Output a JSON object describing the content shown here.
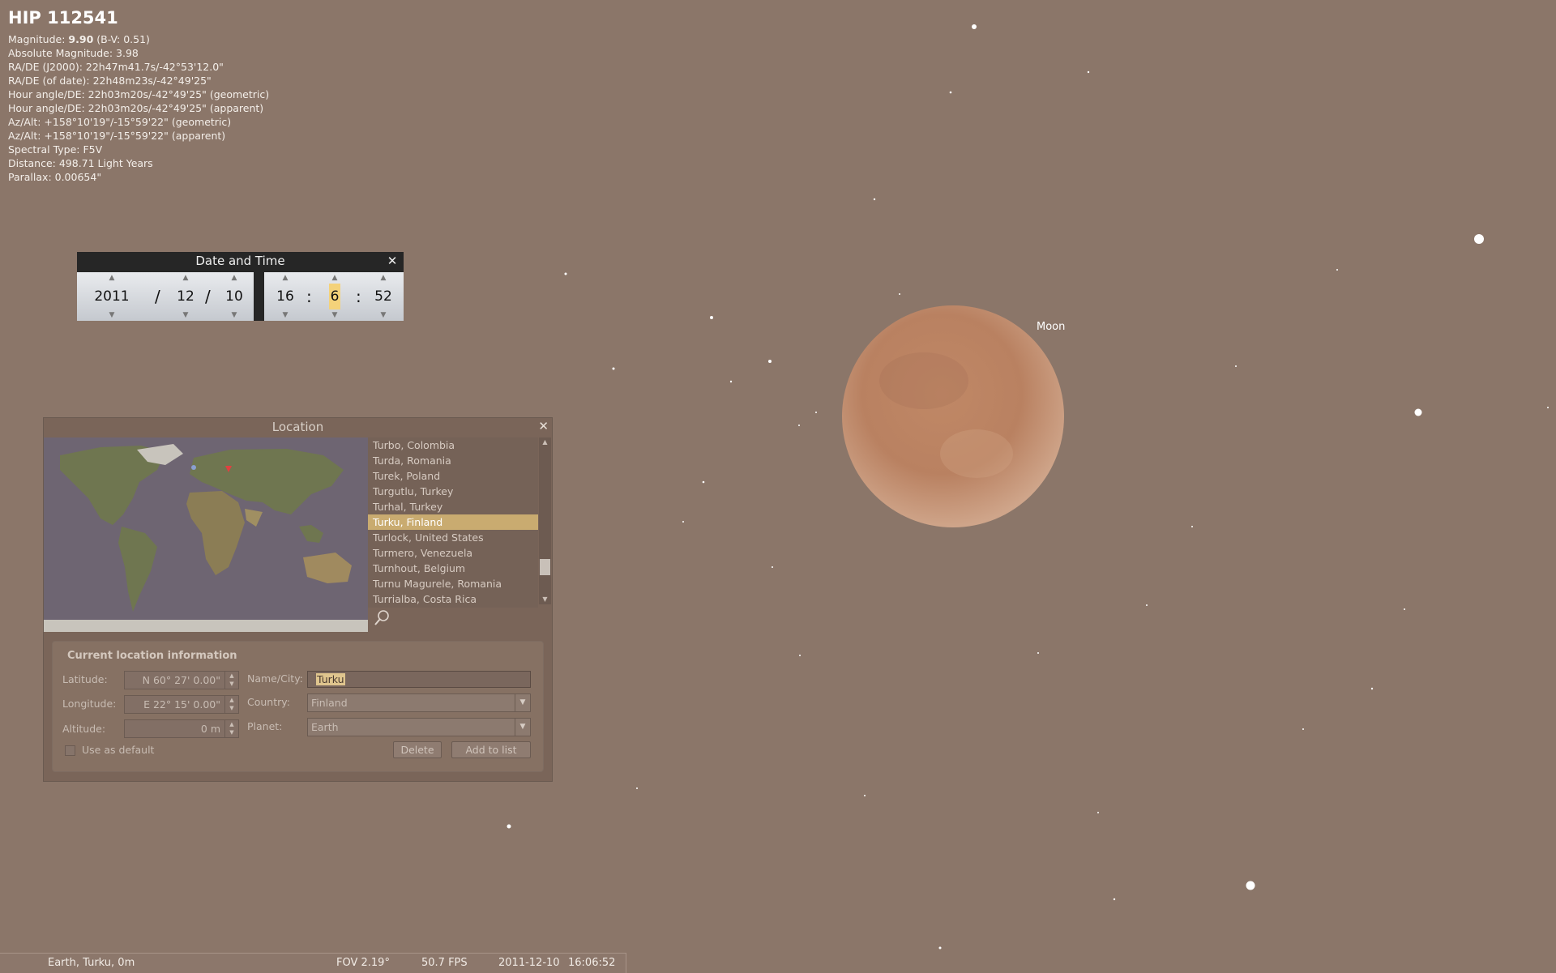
{
  "object_info": {
    "title": "HIP 112541",
    "magnitude_label": "Magnitude:",
    "magnitude_value": "9.90",
    "magnitude_extra": "(B-V: 0.51)",
    "lines": [
      "Absolute Magnitude: 3.98",
      "RA/DE (J2000): 22h47m41.7s/-42°53'12.0\"",
      "RA/DE (of date): 22h48m23s/-42°49'25\"",
      "Hour angle/DE: 22h03m20s/-42°49'25\" (geometric)",
      "Hour angle/DE: 22h03m20s/-42°49'25\" (apparent)",
      "Az/Alt: +158°10'19\"/-15°59'22\" (geometric)",
      "Az/Alt: +158°10'19\"/-15°59'22\" (apparent)",
      "Spectral Type: F5V",
      "Distance: 498.71 Light Years",
      "Parallax: 0.00654\""
    ]
  },
  "sky": {
    "moon_label": "Moon"
  },
  "datetime": {
    "title": "Date and Time",
    "year": "2011",
    "month": "12",
    "day": "10",
    "hour": "16",
    "minute": "6",
    "second": "52",
    "date_sep": "/",
    "time_sep": ":"
  },
  "location": {
    "title": "Location",
    "cities": [
      "Turbo, Colombia",
      "Turda, Romania",
      "Turek, Poland",
      "Turgutlu, Turkey",
      "Turhal, Turkey",
      "Turku, Finland",
      "Turlock, United States",
      "Turmero, Venezuela",
      "Turnhout, Belgium",
      "Turnu Magurele, Romania",
      "Turrialba, Costa Rica"
    ],
    "selected_city": "Turku, Finland",
    "info_heading": "Current location information",
    "latitude_label": "Latitude:",
    "latitude_value": "N 60° 27' 0.00\"",
    "longitude_label": "Longitude:",
    "longitude_value": "E 22° 15' 0.00\"",
    "altitude_label": "Altitude:",
    "altitude_value": "0 m",
    "name_label": "Name/City:",
    "name_value": "Turku",
    "country_label": "Country:",
    "country_value": "Finland",
    "planet_label": "Planet:",
    "planet_value": "Earth",
    "default_label": "Use as default",
    "delete_label": "Delete",
    "add_label": "Add to list"
  },
  "statusbar": {
    "location": "Earth, Turku, 0m",
    "fov": "FOV 2.19°",
    "fps": "50.7 FPS",
    "date": "2011-12-10",
    "time": "16:06:52"
  }
}
